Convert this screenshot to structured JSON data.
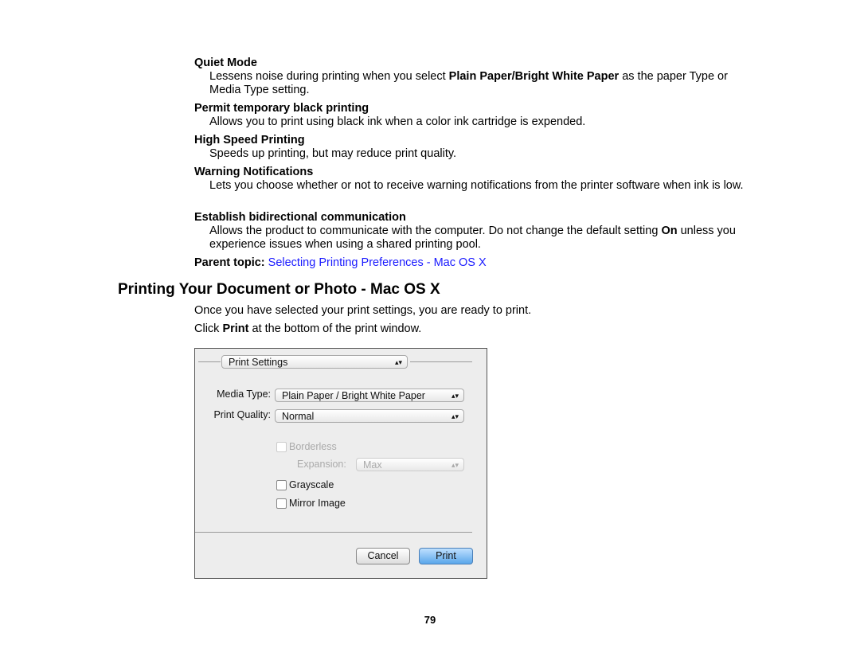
{
  "items": [
    {
      "title": "Quiet Mode",
      "desc_parts": [
        "Lessens noise during printing when you select ",
        "Plain Paper",
        "/",
        "Bright White Paper",
        " as the paper Type or Media Type setting."
      ]
    },
    {
      "title": "Permit temporary black printing",
      "desc": "Allows you to print using black ink when a color ink cartridge is expended."
    },
    {
      "title": "High Speed Printing",
      "desc": "Speeds up printing, but may reduce print quality."
    },
    {
      "title": "Warning Notifications",
      "desc": "Lets you choose whether or not to receive warning notifications from the printer software when ink is low."
    },
    {
      "title": "Establish bidirectional communication",
      "desc_parts": [
        "Allows the product to communicate with the computer. Do not change the default setting ",
        "On",
        " unless you experience issues when using a shared printing pool."
      ]
    }
  ],
  "parent_topic": {
    "label": "Parent topic:",
    "link": "Selecting Printing Preferences - Mac OS X"
  },
  "section": {
    "title": "Printing Your Document or Photo - Mac OS X",
    "p1": "Once you have selected your print settings, you are ready to print.",
    "p2_parts": [
      "Click ",
      "Print",
      " at the bottom of the print window."
    ]
  },
  "dialog": {
    "panel": "Print Settings",
    "media_type_label": "Media Type:",
    "media_type": "Plain Paper / Bright White Paper",
    "quality_label": "Print Quality:",
    "quality": "Normal",
    "borderless": "Borderless",
    "expansion_label": "Expansion:",
    "expansion": "Max",
    "grayscale": "Grayscale",
    "mirror": "Mirror Image",
    "cancel": "Cancel",
    "print": "Print"
  },
  "page_number": "79"
}
